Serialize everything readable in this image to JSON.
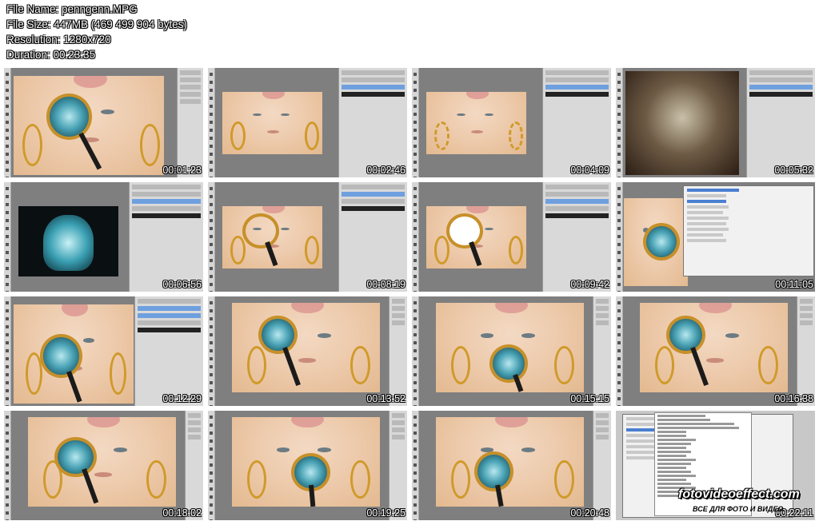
{
  "header": {
    "file_name": "File Name: penngenn.MPG",
    "file_size": "File Size: 447MB (469 499 904 bytes)",
    "resolution": "Resolution: 1280x720",
    "duration": "Duration: 00:23:35"
  },
  "thumbnails": [
    {
      "timestamp": "00:01:23",
      "scene": "face-magnifier"
    },
    {
      "timestamp": "00:02:46",
      "scene": "face-plain"
    },
    {
      "timestamp": "00:04:09",
      "scene": "face-selection"
    },
    {
      "timestamp": "00:05:32",
      "scene": "skull-overlay"
    },
    {
      "timestamp": "00:06:56",
      "scene": "xray-skull"
    },
    {
      "timestamp": "00:08:19",
      "scene": "face-magnifier-outline"
    },
    {
      "timestamp": "00:09:42",
      "scene": "face-magnifier-white"
    },
    {
      "timestamp": "00:11:05",
      "scene": "layer-style-dialog"
    },
    {
      "timestamp": "00:12:29",
      "scene": "face-magnifier"
    },
    {
      "timestamp": "00:13:52",
      "scene": "face-magnifier"
    },
    {
      "timestamp": "00:15:15",
      "scene": "face-magnifier-mouth"
    },
    {
      "timestamp": "00:16:38",
      "scene": "face-magnifier"
    },
    {
      "timestamp": "00:18:02",
      "scene": "face-magnifier"
    },
    {
      "timestamp": "00:19:25",
      "scene": "face-magnifier-mouth"
    },
    {
      "timestamp": "00:20:48",
      "scene": "face-magnifier-mouth"
    },
    {
      "timestamp": "00:22:11",
      "scene": "export-dialog"
    }
  ],
  "watermark": {
    "site": "fotovideoeffect.com",
    "tagline": "ВСЕ ДЛЯ ФОТО И ВИДЕО"
  },
  "colors": {
    "background": "#ffffff",
    "ps_gray": "#7f7f7f",
    "skin": "#ecc8a8",
    "gold": "#c7902a",
    "xray": "#4aa3b5",
    "selection_blue": "#6ea0df"
  }
}
